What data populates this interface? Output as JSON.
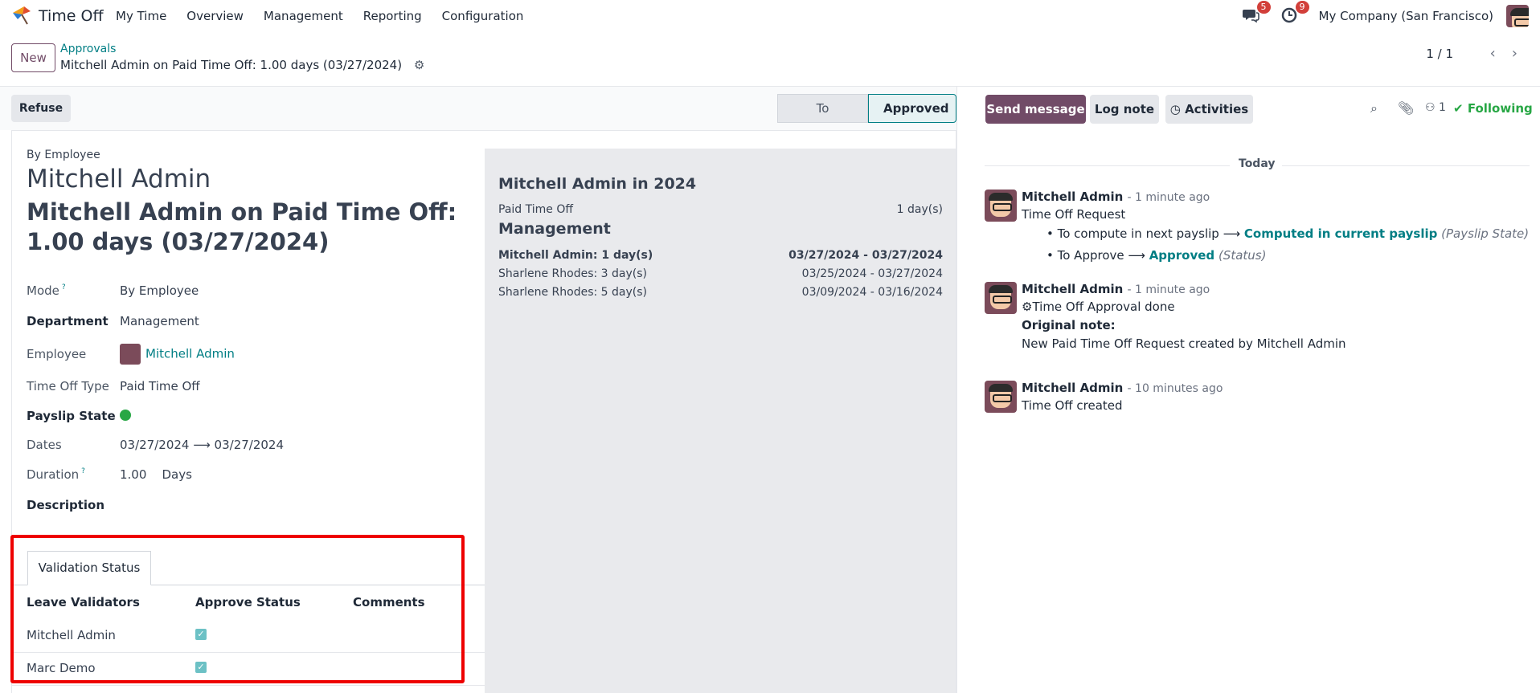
{
  "app": {
    "name": "Time Off",
    "menu": [
      "My Time",
      "Overview",
      "Management",
      "Reporting",
      "Configuration"
    ]
  },
  "topbar": {
    "messages_count": "5",
    "activities_count": "9",
    "company": "My Company (San Francisco)"
  },
  "control": {
    "new_label": "New",
    "breadcrumb_parent": "Approvals",
    "breadcrumb_current": "Mitchell Admin on Paid Time Off: 1.00 days (03/27/2024)",
    "pager": "1 / 1"
  },
  "status": {
    "refuse_label": "Refuse",
    "stages": [
      "To Approve",
      "Approved"
    ],
    "active_stage": "Approved"
  },
  "form": {
    "mode_label": "By Employee",
    "employee_name": "Mitchell Admin",
    "title": "Mitchell Admin on Paid Time Off: 1.00 days (03/27/2024)",
    "fields": {
      "mode": {
        "label": "Mode",
        "value": "By Employee"
      },
      "department": {
        "label": "Department",
        "value": "Management"
      },
      "employee": {
        "label": "Employee",
        "value": "Mitchell Admin"
      },
      "type": {
        "label": "Time Off Type",
        "value": "Paid Time Off"
      },
      "payslip": {
        "label": "Payslip State"
      },
      "dates": {
        "label": "Dates",
        "from": "03/27/2024",
        "to": "03/27/2024"
      },
      "duration": {
        "label": "Duration",
        "value": "1.00",
        "unit": "Days"
      },
      "description": {
        "label": "Description"
      }
    }
  },
  "summary": {
    "heading": "Mitchell Admin in 2024",
    "allocation": {
      "label": "Paid Time Off",
      "value": "1 day(s)"
    },
    "dept_heading": "Management",
    "rows": [
      {
        "name": "Mitchell Admin: 1 day(s)",
        "dates": "03/27/2024 - 03/27/2024"
      },
      {
        "name": "Sharlene Rhodes: 3 day(s)",
        "dates": "03/25/2024 - 03/27/2024"
      },
      {
        "name": "Sharlene Rhodes: 5 day(s)",
        "dates": "03/09/2024 - 03/16/2024"
      }
    ]
  },
  "validation": {
    "tab_label": "Validation Status",
    "headers": [
      "Leave Validators",
      "Approve Status",
      "Comments"
    ],
    "rows": [
      {
        "name": "Mitchell Admin",
        "approved": true
      },
      {
        "name": "Marc Demo",
        "approved": true
      }
    ]
  },
  "chatter": {
    "send_message": "Send message",
    "log_note": "Log note",
    "activities": "Activities",
    "followers_count": "1",
    "following": "Following",
    "day_label": "Today",
    "messages": [
      {
        "author": "Mitchell Admin",
        "time": "- 1 minute ago",
        "text": "Time Off Request",
        "changes": [
          {
            "old": "To compute in next payslip",
            "new": "Computed in current payslip",
            "field": "(Payslip State)"
          },
          {
            "old": "To Approve",
            "new": "Approved",
            "field": "(Status)"
          }
        ]
      },
      {
        "author": "Mitchell Admin",
        "time": "- 1 minute ago",
        "text": "Time Off Approval done",
        "note_label": "Original note:",
        "note": "New Paid Time Off Request created by Mitchell Admin"
      },
      {
        "author": "Mitchell Admin",
        "time": "- 10 minutes ago",
        "text": "Time Off created"
      }
    ]
  }
}
